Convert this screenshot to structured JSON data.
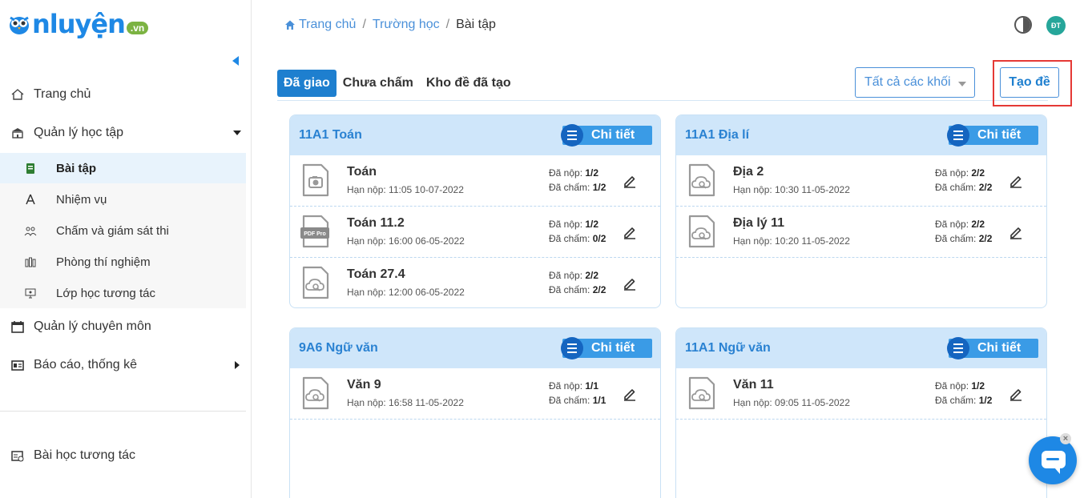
{
  "logo": {
    "text": "nluyện",
    "suffix": ".vn"
  },
  "sidebar": {
    "items": [
      {
        "label": "Trang chủ"
      },
      {
        "label": "Quản lý học tập"
      },
      {
        "label": "Quản lý chuyên môn"
      },
      {
        "label": "Báo cáo, thống kê"
      },
      {
        "label": "Bài học tương tác"
      }
    ],
    "subitems": [
      {
        "label": "Bài tập"
      },
      {
        "label": "Nhiệm vụ"
      },
      {
        "label": "Chấm và giám sát thi"
      },
      {
        "label": "Phòng thí nghiệm"
      },
      {
        "label": "Lớp học tương tác"
      }
    ]
  },
  "breadcrumb": {
    "home": "Trang chủ",
    "school": "Trường học",
    "current": "Bài tập"
  },
  "header": {
    "avatar_initials": "ĐT"
  },
  "tabs": [
    {
      "label": "Đã giao"
    },
    {
      "label": "Chưa chấm"
    },
    {
      "label": "Kho đề đã tạo"
    }
  ],
  "filter": {
    "grade_select": "Tất cả các khối"
  },
  "actions": {
    "create": "Tạo đề"
  },
  "labels": {
    "detail": "Chi tiết",
    "due": "Hạn nộp:",
    "submitted": "Đã nộp:",
    "graded": "Đã chấm:"
  },
  "cards": [
    {
      "title": "11A1 Toán",
      "rows": [
        {
          "name": "Toán",
          "due": "11:05 10-07-2022",
          "submitted": "1/2",
          "graded": "1/2",
          "file_icon": "camera-file-icon"
        },
        {
          "name": "Toán 11.2",
          "due": "16:00 06-05-2022",
          "submitted": "1/2",
          "graded": "0/2",
          "file_icon": "pdf-file-icon",
          "pdf_label": "PDF Pro"
        },
        {
          "name": "Toán 27.4",
          "due": "12:00 06-05-2022",
          "submitted": "2/2",
          "graded": "2/2",
          "file_icon": "cloud-search-file-icon"
        }
      ]
    },
    {
      "title": "11A1 Địa lí",
      "rows": [
        {
          "name": "Địa 2",
          "due": "10:30 11-05-2022",
          "submitted": "2/2",
          "graded": "2/2",
          "file_icon": "cloud-search-file-icon"
        },
        {
          "name": "Địa lý 11",
          "due": "10:20 11-05-2022",
          "submitted": "2/2",
          "graded": "2/2",
          "file_icon": "cloud-search-file-icon"
        }
      ]
    },
    {
      "title": "9A6 Ngữ văn",
      "rows": [
        {
          "name": "Văn 9",
          "due": "16:58 11-05-2022",
          "submitted": "1/1",
          "graded": "1/1",
          "file_icon": "cloud-search-file-icon"
        }
      ]
    },
    {
      "title": "11A1 Ngữ văn",
      "rows": [
        {
          "name": "Văn 11",
          "due": "09:05 11-05-2022",
          "submitted": "1/2",
          "graded": "1/2",
          "file_icon": "cloud-search-file-icon"
        }
      ]
    }
  ],
  "colors": {
    "primary": "#1e7fcf",
    "card_header": "#cfe6fa",
    "highlight": "#e53935"
  }
}
